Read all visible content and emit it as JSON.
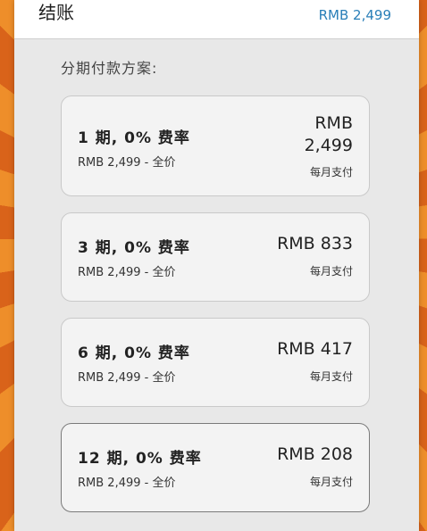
{
  "header": {
    "title": "结账",
    "total": "RMB 2,499"
  },
  "section_label": "分期付款方案:",
  "plans": [
    {
      "title": "1 期, 0% 费率",
      "subtitle": "RMB 2,499 - 全价",
      "price_line1": "RMB",
      "price_line2": "2,499",
      "note": "每月支付",
      "selected": false
    },
    {
      "title": "3 期, 0% 费率",
      "subtitle": "RMB 2,499 - 全价",
      "price": "RMB 833",
      "note": "每月支付",
      "selected": false
    },
    {
      "title": "6 期, 0% 费率",
      "subtitle": "RMB 2,499 - 全价",
      "price": "RMB 417",
      "note": "每月支付",
      "selected": false
    },
    {
      "title": "12 期, 0% 费率",
      "subtitle": "RMB 2,499 - 全价",
      "price": "RMB 208",
      "note": "每月支付",
      "selected": true
    }
  ],
  "colors": {
    "accent": "#2a7fb8",
    "background_orange": "#e07a1e"
  }
}
